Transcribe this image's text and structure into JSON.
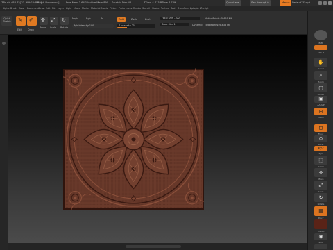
{
  "titlebar": {
    "app_info": "ZBrush 4R8 P2[ZG-HHH1-HHH3]",
    "document": "[ZBrush Document]",
    "free_mem": "Free Mem 3.64GB",
    "active_mem": "Active Mem 890",
    "scratch": "Scratch Disk 48",
    "timers": "ZTime 4.713 RTime 4.749",
    "quicksave": "QuickSave",
    "see_through": "See-through 0",
    "menus": "Menus",
    "default_script": "DefaultZScript"
  },
  "menubar": {
    "items": [
      "Alpha",
      "Brush",
      "Color",
      "Document",
      "Draw",
      "Edit",
      "File",
      "Layer",
      "Light",
      "Macro",
      "Marker",
      "Material",
      "Movie",
      "Picker",
      "Preferences",
      "Render",
      "Stencil",
      "Stroke",
      "Texture",
      "Tool",
      "Transform",
      "Zplugin",
      "Zscript"
    ]
  },
  "toolbar": {
    "quicksketch": "Quick Sketch",
    "edit": "Edit",
    "draw": "Draw",
    "move": "Move",
    "scale": "Scale",
    "rotate": "Rotate",
    "mrgb": "Mrgb",
    "rgb": "Rgb",
    "m": "M",
    "zadd": "Zadd",
    "zsub": "Zsub",
    "zcut": "Zcut",
    "rgb_intensity": "Rgb Intensity 100",
    "z_intensity": "Z Intensity 25",
    "z_intensity_value": 25,
    "focal_shift": "Focal Shift -100",
    "draw_size": "Draw Size 1",
    "dynamic": "Dynamic",
    "active_points": "ActivePoints: 5.429 Mil",
    "total_points": "TotalPoints: 6.438 Mil"
  },
  "rightshelf": {
    "labels": [
      "BPR",
      "SPix 3",
      "Scroll",
      "Zoom",
      "Actual",
      "AAHalf",
      "Persp",
      "Floor",
      "Local",
      "Sym",
      "Frame",
      "Move",
      "Scale",
      "Rotate",
      "PolyF",
      "Transp",
      "Solo",
      "Xpose"
    ]
  },
  "colors": {
    "accent": "#e87b22",
    "model": "#6a3a2b"
  }
}
